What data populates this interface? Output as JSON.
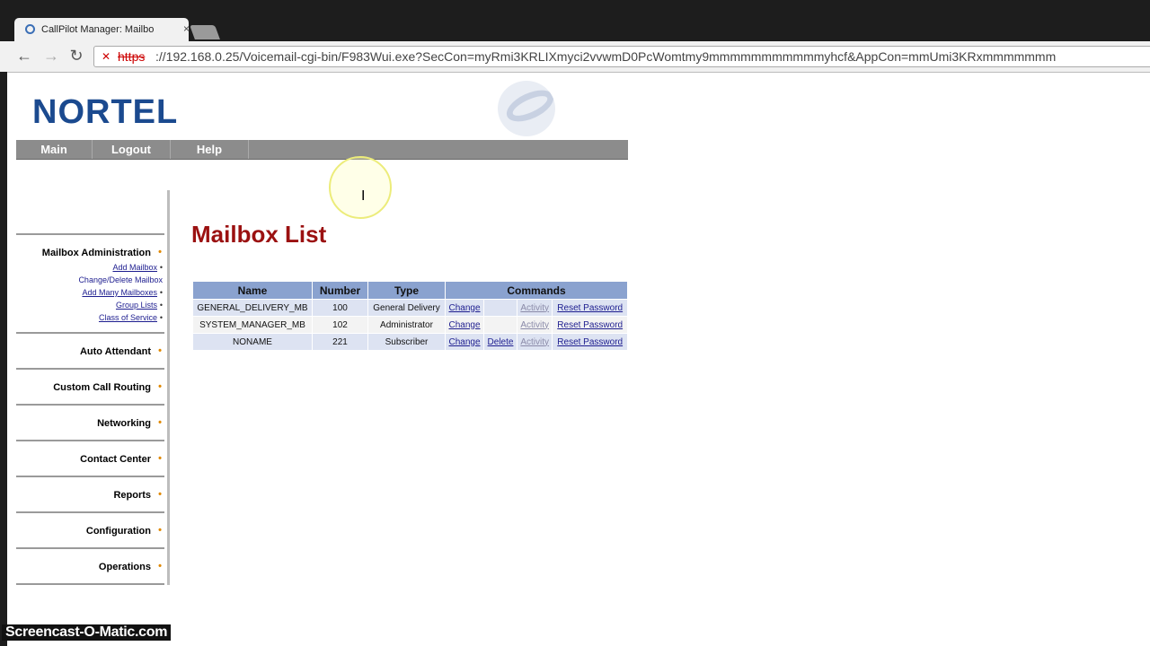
{
  "browser": {
    "tab_title": "CallPilot Manager: Mailbo",
    "tab_close": "×",
    "url_scheme": "https",
    "url_rest": "://192.168.0.25/Voicemail-cgi-bin/F983Wui.exe?SecCon=myRmi3KRLIXmyci2vvwmD0PcWomtmy9mmmmmmmmmmmyhcf&AppCon=mmUmi3KRxmmmmmmm",
    "back_icon": "←",
    "forward_icon": "→",
    "reload_icon": "↻"
  },
  "header": {
    "logo_text": "NORTEL"
  },
  "menu": {
    "items": [
      "Main",
      "Logout",
      "Help"
    ]
  },
  "sidebar": {
    "mailbox_admin": "Mailbox Administration",
    "links": [
      "Add Mailbox",
      "Change/Delete Mailbox",
      "Add Many Mailboxes",
      "Group Lists",
      "Class of Service"
    ],
    "sections": [
      "Auto Attendant",
      "Custom Call Routing",
      "Networking",
      "Contact Center",
      "Reports",
      "Configuration",
      "Operations"
    ],
    "star": "•",
    "dot": "•"
  },
  "main": {
    "title": "Mailbox List",
    "columns": [
      "Name",
      "Number",
      "Type",
      "Commands"
    ],
    "rows": [
      {
        "name": "GENERAL_DELIVERY_MB",
        "number": "100",
        "type": "General Delivery",
        "change": "Change",
        "delete": "",
        "activity": "Activity",
        "reset": "Reset Password"
      },
      {
        "name": "SYSTEM_MANAGER_MB",
        "number": "102",
        "type": "Administrator",
        "change": "Change",
        "delete": "",
        "activity": "Activity",
        "reset": "Reset Password"
      },
      {
        "name": "NONAME",
        "number": "221",
        "type": "Subscriber",
        "change": "Change",
        "delete": "Delete",
        "activity": "Activity",
        "reset": "Reset Password"
      }
    ]
  },
  "watermark": "Screencast-O-Matic.com"
}
